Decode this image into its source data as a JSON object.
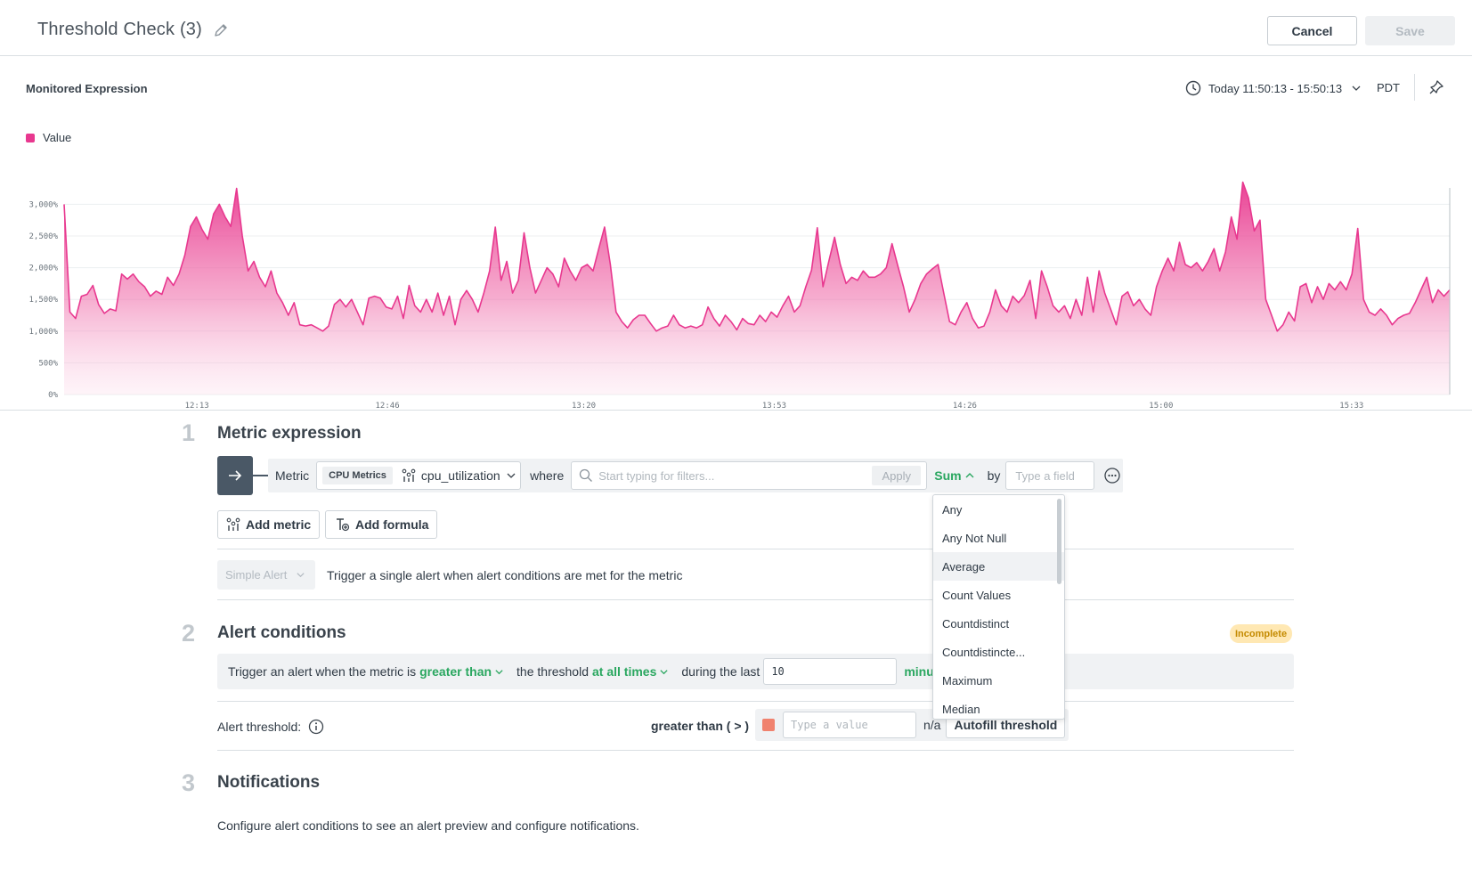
{
  "header": {
    "title": "Threshold Check (3)",
    "cancel_label": "Cancel",
    "save_label": "Save"
  },
  "chart_section": {
    "label": "Monitored Expression",
    "time_range": "Today 11:50:13 - 15:50:13",
    "timezone": "PDT"
  },
  "colors": {
    "series": "#e8388f",
    "accent_green": "#2aa760",
    "threshold_swatch": "#f0826e",
    "badge_bg": "#ffe8b3"
  },
  "chart_data": {
    "type": "area",
    "title": "",
    "xlabel": "",
    "ylabel": "",
    "ylim": [
      0,
      3000
    ],
    "y_ticks": [
      "0%",
      "500%",
      "1,000%",
      "1,500%",
      "2,000%",
      "2,500%",
      "3,000%"
    ],
    "x_ticks": [
      "12:13",
      "12:46",
      "13:20",
      "13:53",
      "14:26",
      "15:00",
      "15:33"
    ],
    "x_range_minutes": [
      710,
      950
    ],
    "grid": true,
    "legend": "top-left",
    "series": [
      {
        "name": "Value",
        "values": [
          3000,
          1300,
          1200,
          1550,
          1580,
          1720,
          1420,
          1280,
          1350,
          1320,
          1900,
          1820,
          1900,
          1780,
          1700,
          1550,
          1630,
          1580,
          1850,
          1720,
          1900,
          2200,
          2650,
          2800,
          2600,
          2450,
          2850,
          3000,
          2800,
          2650,
          3250,
          2500,
          1950,
          2100,
          1850,
          1700,
          1950,
          1600,
          1450,
          1250,
          1450,
          1100,
          1080,
          1100,
          1050,
          1000,
          1080,
          1420,
          1500,
          1380,
          1500,
          1300,
          1100,
          1520,
          1550,
          1520,
          1380,
          1350,
          1550,
          1200,
          1720,
          1400,
          1300,
          1500,
          1300,
          1600,
          1250,
          1550,
          1100,
          1500,
          1640,
          1500,
          1300,
          1600,
          1950,
          2640,
          1800,
          2100,
          1600,
          1800,
          2550,
          2000,
          1600,
          1800,
          2000,
          1900,
          1700,
          2150,
          1950,
          1800,
          2000,
          2050,
          1950,
          2300,
          2640,
          2050,
          1300,
          1150,
          1050,
          1180,
          1250,
          1250,
          1120,
          1000,
          1050,
          1080,
          1250,
          1100,
          1050,
          1080,
          1050,
          1100,
          1380,
          1200,
          1080,
          1250,
          1150,
          1020,
          1200,
          1120,
          1100,
          1250,
          1150,
          1300,
          1220,
          1400,
          1550,
          1300,
          1400,
          1700,
          1960,
          2630,
          1700,
          2100,
          2480,
          2050,
          1750,
          1850,
          1800,
          1950,
          1850,
          1850,
          1900,
          2000,
          2380,
          2030,
          1700,
          1300,
          1500,
          1750,
          1900,
          1980,
          2050,
          1600,
          1150,
          1100,
          1300,
          1450,
          1200,
          1050,
          1080,
          1300,
          1650,
          1400,
          1300,
          1550,
          1450,
          1560,
          1800,
          1200,
          1950,
          1700,
          1400,
          1300,
          1400,
          1200,
          1500,
          1250,
          1850,
          1300,
          1950,
          1600,
          1350,
          1100,
          1550,
          1620,
          1400,
          1500,
          1350,
          1250,
          1700,
          1950,
          2150,
          1950,
          2400,
          2050,
          2000,
          2080,
          1950,
          2100,
          2300,
          1950,
          2250,
          2800,
          2450,
          3350,
          3100,
          2580,
          2750,
          1500,
          1250,
          1000,
          1100,
          1300,
          1160,
          1700,
          1750,
          1450,
          1700,
          1500,
          1750,
          1650,
          1780,
          1650,
          1900,
          2620,
          1500,
          1300,
          1250,
          1350,
          1250,
          1100,
          1200,
          1250,
          1280,
          1450,
          1650,
          1850,
          1450,
          1650,
          1550,
          1650
        ]
      }
    ]
  },
  "step1": {
    "number": "1",
    "title": "Metric expression",
    "metric_label": "Metric",
    "metric_source": "CPU Metrics",
    "metric_name": "cpu_utilization",
    "where_label": "where",
    "filter_placeholder": "Start typing for filters...",
    "apply_label": "Apply",
    "aggregation": "Sum",
    "by_label": "by",
    "field_placeholder": "Type a field",
    "add_metric_label": "Add metric",
    "add_formula_label": "Add formula",
    "alert_type": "Simple Alert",
    "alert_type_desc": "Trigger a single alert when alert conditions are met for the metric"
  },
  "aggregation_dropdown": {
    "options": [
      "Any",
      "Any Not Null",
      "Average",
      "Count Values",
      "Countdistinct",
      "Countdistincte...",
      "Maximum",
      "Median"
    ],
    "highlighted": "Average"
  },
  "step2": {
    "number": "2",
    "title": "Alert conditions",
    "badge": "Incomplete",
    "cond_prefix": "Trigger an alert when the metric is",
    "cond_comparison": "greater than",
    "cond_threshold_text": "the threshold",
    "cond_times": "at all times",
    "cond_during": "during the last",
    "cond_value": "10",
    "cond_unit": "minu",
    "threshold_label": "Alert threshold:",
    "threshold_comparison": "greater than ( > )",
    "threshold_placeholder": "Type a value",
    "threshold_na": "n/a",
    "autofill_label": "Autofill threshold"
  },
  "step3": {
    "number": "3",
    "title": "Notifications",
    "desc": "Configure alert conditions to see an alert preview and configure notifications."
  }
}
